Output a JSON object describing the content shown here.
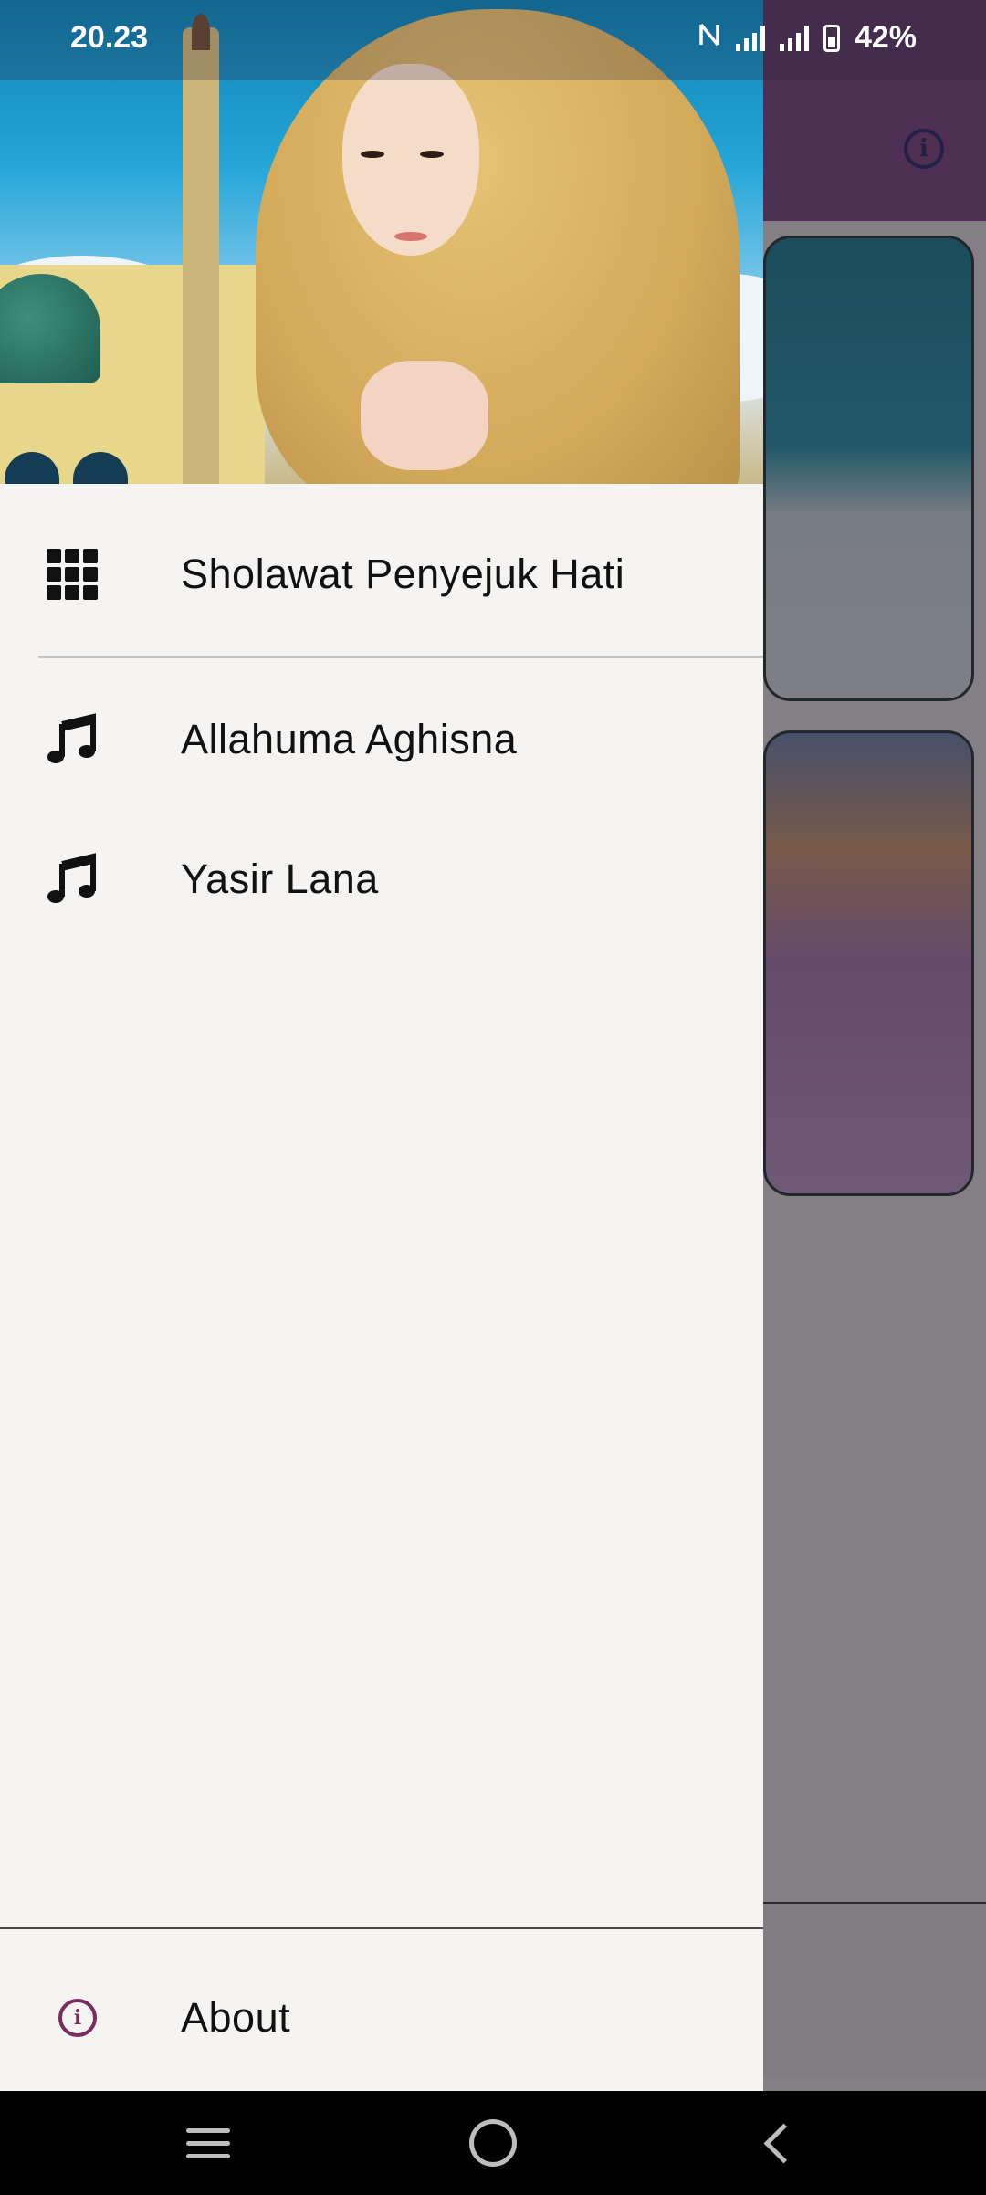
{
  "status_bar": {
    "time": "20.23",
    "nfc_icon": "nfc-icon",
    "battery_percent": "42%"
  },
  "drawer": {
    "header_image": "hijab-woman-mosque-photo",
    "items": [
      {
        "label": "Sholawat Penyejuk Hati",
        "icon": "grid-icon"
      },
      {
        "label": "Allahuma Aghisna",
        "icon": "music-note-icon"
      },
      {
        "label": "Yasir Lana",
        "icon": "music-note-icon"
      }
    ],
    "footer": {
      "label": "About",
      "icon": "info-icon"
    }
  },
  "background_app": {
    "toolbar_icon": "info-icon",
    "accent_color": "#7b3f86"
  },
  "nav_bar": {
    "recents": "recents-icon",
    "home": "home-icon",
    "back": "back-icon"
  }
}
